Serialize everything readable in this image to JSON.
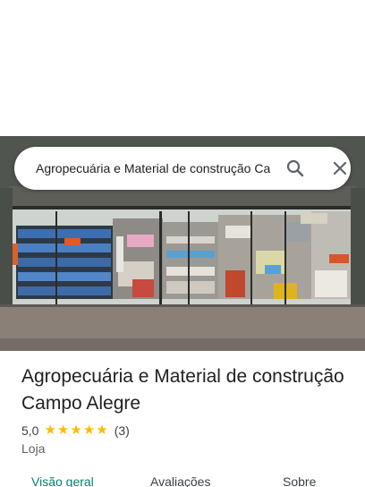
{
  "search": {
    "query": "Agropecuária e Material de construção Campo Alegre"
  },
  "place": {
    "title": "Agropecuária e Material de construção Campo Alegre",
    "rating_value": "5,0",
    "rating_stars": 5,
    "review_count": "(3)",
    "category": "Loja"
  },
  "tabs": [
    {
      "label": "Visão geral",
      "active": true
    },
    {
      "label": "Avaliações",
      "active": false
    },
    {
      "label": "Sobre",
      "active": false
    }
  ],
  "colors": {
    "star": "#fbbc04",
    "active_tab": "#0b7d6c",
    "text_primary": "#202124",
    "text_secondary": "#5f6368"
  },
  "icons": {
    "search": "search-icon",
    "close": "close-icon",
    "star": "star-icon"
  }
}
